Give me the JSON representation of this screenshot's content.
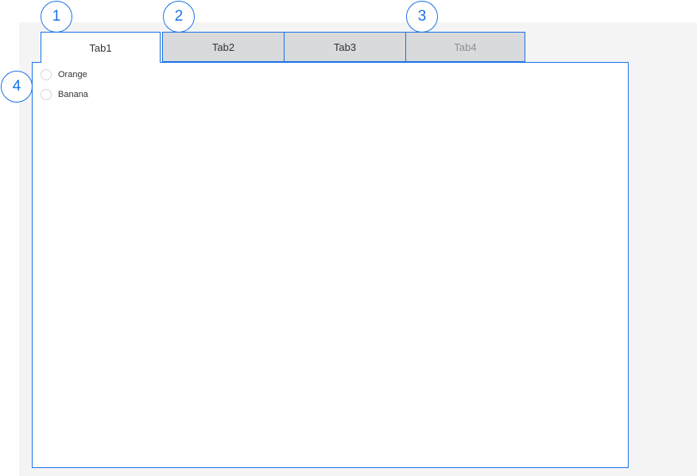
{
  "tabs": [
    {
      "label": "Tab1",
      "state": "selected"
    },
    {
      "label": "Tab2",
      "state": "normal"
    },
    {
      "label": "Tab3",
      "state": "normal"
    },
    {
      "label": "Tab4",
      "state": "disabled"
    }
  ],
  "panel": {
    "options": [
      {
        "label": "Orange",
        "selected": false
      },
      {
        "label": "Banana",
        "selected": false
      }
    ]
  },
  "callouts": [
    "1",
    "2",
    "3",
    "4"
  ],
  "colors": {
    "accent": "#1a73e8",
    "tab_inactive_bg": "#d8dadb",
    "disabled_text": "#8f8f8f",
    "page_bg": "#f4f4f4"
  }
}
